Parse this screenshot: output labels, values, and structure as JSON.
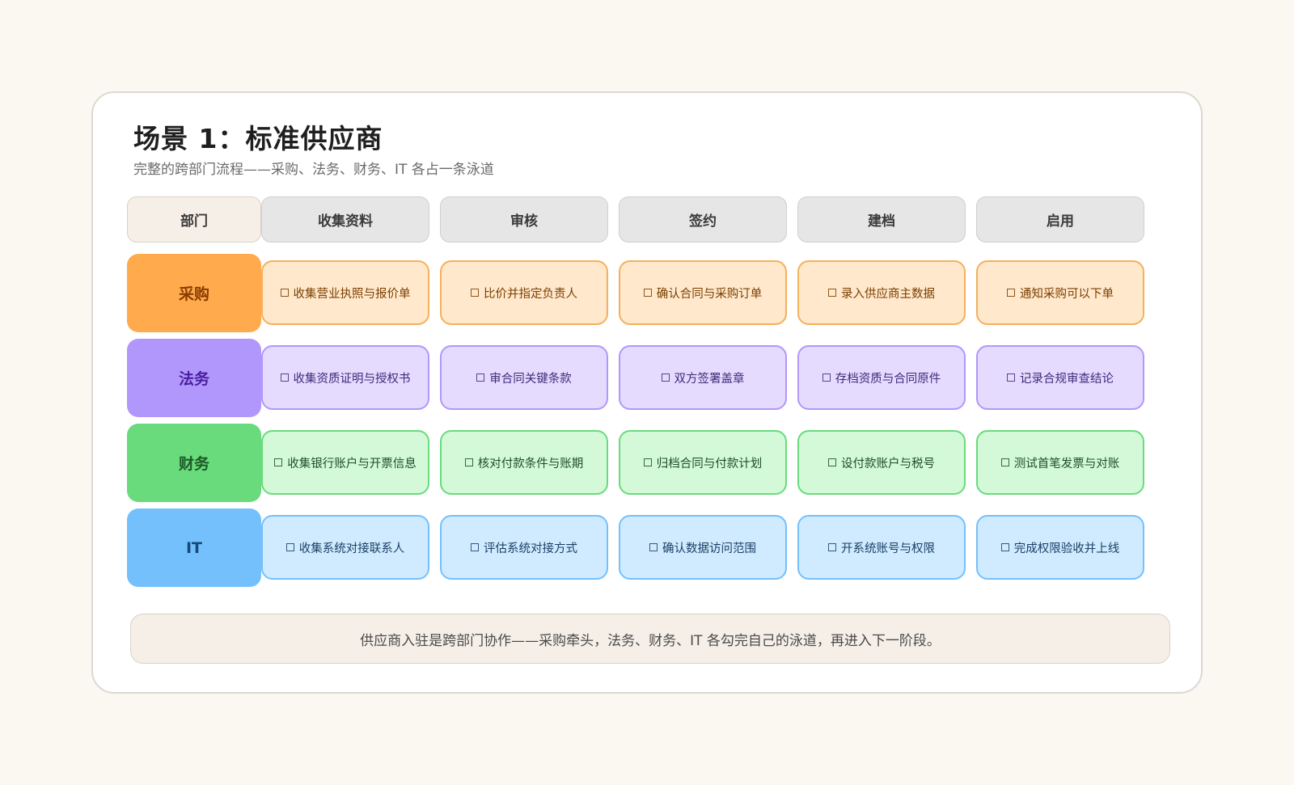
{
  "title": "场景 1：标准供应商",
  "subtitle": "完整的跨部门流程——采购、法务、财务、IT 各占一条泳道",
  "header": {
    "corner": "部门",
    "stages": [
      "收集资料",
      "审核",
      "签约",
      "建档",
      "启用"
    ]
  },
  "lanes": [
    {
      "name": "采购",
      "colors": {
        "lane": "#ffab4d",
        "text": "#8a3b00",
        "fill": "#ffe8cc",
        "border": "#f5b05c",
        "taskText": "#7a3e00"
      },
      "tasks": [
        "收集营业执照与报价单",
        "比价并指定负责人",
        "确认合同与采购订单",
        "录入供应商主数据",
        "通知采购可以下单"
      ]
    },
    {
      "name": "法务",
      "colors": {
        "lane": "#b197fc",
        "text": "#4b1fa0",
        "fill": "#e5dbff",
        "border": "#b197fc",
        "taskText": "#3e2a78"
      },
      "tasks": [
        "收集资质证明与授权书",
        "审合同关键条款",
        "双方签署盖章",
        "存档资质与合同原件",
        "记录合规审查结论"
      ]
    },
    {
      "name": "财务",
      "colors": {
        "lane": "#69db7c",
        "text": "#1c5c26",
        "fill": "#d3f9d8",
        "border": "#69db7c",
        "taskText": "#1f4d26"
      },
      "tasks": [
        "收集银行账户与开票信息",
        "核对付款条件与账期",
        "归档合同与付款计划",
        "设付款账户与税号",
        "测试首笔发票与对账"
      ]
    },
    {
      "name": "IT",
      "colors": {
        "lane": "#74c0fc",
        "text": "#14497a",
        "fill": "#d0ebff",
        "border": "#74c0fc",
        "taskText": "#1a3f66"
      },
      "tasks": [
        "收集系统对接联系人",
        "评估系统对接方式",
        "确认数据访问范围",
        "开系统账号与权限",
        "完成权限验收并上线"
      ]
    }
  ],
  "footer": "供应商入驻是跨部门协作——采购牵头，法务、财务、IT 各勾完自己的泳道，再进入下一阶段。"
}
